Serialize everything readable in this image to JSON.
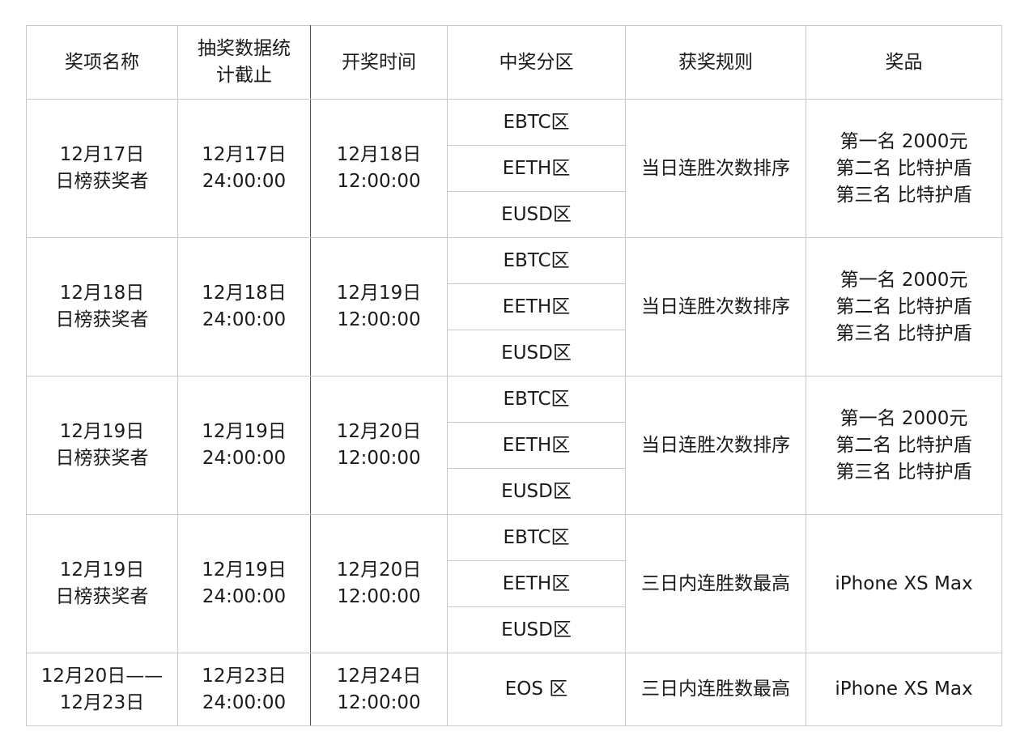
{
  "headers": {
    "name": "奖项名称",
    "cutoff_line1": "抽奖数据统",
    "cutoff_line2": "计截止",
    "draw_time": "开奖时间",
    "zone": "中奖分区",
    "rule": "获奖规则",
    "prize": "奖品"
  },
  "groups": [
    {
      "name_line1": "12月17日",
      "name_line2": "日榜获奖者",
      "cutoff_date": "12月17日",
      "cutoff_time": "24:00:00",
      "draw_date": "12月18日",
      "draw_time": "12:00:00",
      "zones": [
        "EBTC区",
        "EETH区",
        "EUSD区"
      ],
      "rule": "当日连胜次数排序",
      "prizes": [
        "第一名 2000元",
        "第二名 比特护盾",
        "第三名 比特护盾"
      ]
    },
    {
      "name_line1": "12月18日",
      "name_line2": "日榜获奖者",
      "cutoff_date": "12月18日",
      "cutoff_time": "24:00:00",
      "draw_date": "12月19日",
      "draw_time": "12:00:00",
      "zones": [
        "EBTC区",
        "EETH区",
        "EUSD区"
      ],
      "rule": "当日连胜次数排序",
      "prizes": [
        "第一名 2000元",
        "第二名 比特护盾",
        "第三名 比特护盾"
      ]
    },
    {
      "name_line1": "12月19日",
      "name_line2": "日榜获奖者",
      "cutoff_date": "12月19日",
      "cutoff_time": "24:00:00",
      "draw_date": "12月20日",
      "draw_time": "12:00:00",
      "zones": [
        "EBTC区",
        "EETH区",
        "EUSD区"
      ],
      "rule": "当日连胜次数排序",
      "prizes": [
        "第一名 2000元",
        "第二名 比特护盾",
        "第三名 比特护盾"
      ]
    },
    {
      "name_line1": "12月19日",
      "name_line2": "日榜获奖者",
      "cutoff_date": "12月19日",
      "cutoff_time": "24:00:00",
      "draw_date": "12月20日",
      "draw_time": "12:00:00",
      "zones": [
        "EBTC区",
        "EETH区",
        "EUSD区"
      ],
      "rule": "三日内连胜数最高",
      "prizes": [
        "iPhone XS Max"
      ]
    }
  ],
  "final_row": {
    "name_line1": "12月20日——",
    "name_line2": "12月23日",
    "cutoff_date": "12月23日",
    "cutoff_time": "24:00:00",
    "draw_date": "12月24日",
    "draw_time": "12:00:00",
    "zone": "EOS 区",
    "rule": "三日内连胜数最高",
    "prize": "iPhone XS Max"
  }
}
